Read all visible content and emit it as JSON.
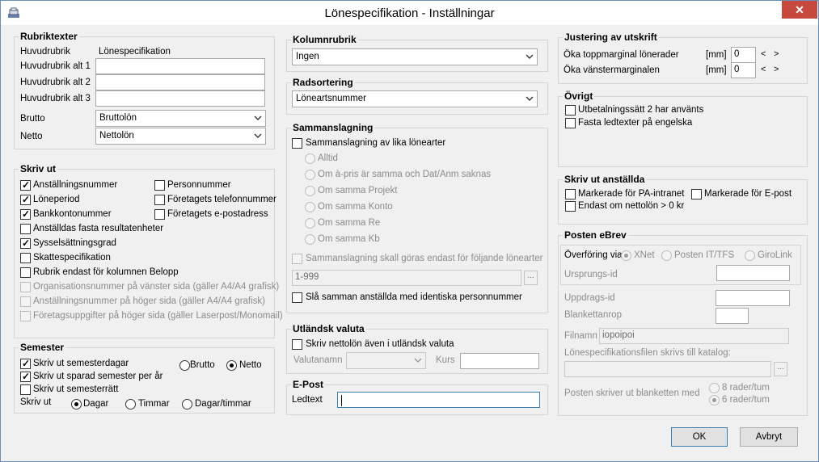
{
  "window": {
    "title": "Lönespecifikation - Inställningar",
    "close": "✕"
  },
  "rubrik": {
    "title": "Rubriktexter",
    "huvudrubrik_label": "Huvudrubrik",
    "huvudrubrik_value": "Lönespecifikation",
    "alt1_label": "Huvudrubrik alt 1",
    "alt1_value": "",
    "alt2_label": "Huvudrubrik alt 2",
    "alt2_value": "",
    "alt3_label": "Huvudrubrik alt 3",
    "alt3_value": "",
    "brutto_label": "Brutto",
    "brutto_value": "Bruttolön",
    "netto_label": "Netto",
    "netto_value": "Nettolön"
  },
  "skrivut": {
    "title": "Skriv ut",
    "items": [
      {
        "label": "Anställningsnummer",
        "checked": true,
        "enabled": true
      },
      {
        "label": "Löneperiod",
        "checked": true,
        "enabled": true
      },
      {
        "label": "Bankkontonummer",
        "checked": true,
        "enabled": true
      },
      {
        "label": "Anställdas fasta resultatenheter",
        "checked": false,
        "enabled": true
      },
      {
        "label": "Sysselsättningsgrad",
        "checked": true,
        "enabled": true
      },
      {
        "label": "Skattespecifikation",
        "checked": false,
        "enabled": true
      },
      {
        "label": "Rubrik endast för kolumnen Belopp",
        "checked": false,
        "enabled": true
      },
      {
        "label": "Organisationsnummer på vänster sida (gäller A4/A4 grafisk)",
        "checked": false,
        "enabled": false
      },
      {
        "label": "Anställningsnummer på höger sida (gäller A4/A4 grafisk)",
        "checked": false,
        "enabled": false
      },
      {
        "label": "Företagsuppgifter på höger sida (gäller Laserpost/Monomail)",
        "checked": false,
        "enabled": false
      }
    ],
    "right_items": [
      {
        "label": "Personnummer",
        "checked": false
      },
      {
        "label": "Företagets telefonnummer",
        "checked": false
      },
      {
        "label": "Företagets e-postadress",
        "checked": false
      }
    ]
  },
  "semester": {
    "title": "Semester",
    "items": [
      {
        "label": "Skriv ut semesterdagar",
        "checked": true
      },
      {
        "label": "Skriv ut sparad semester per år",
        "checked": true
      },
      {
        "label": "Skriv ut semesterrätt",
        "checked": false
      }
    ],
    "brutto_label": "Brutto",
    "netto_label": "Netto",
    "selected_bn": "Netto",
    "skrivut_label": "Skriv ut",
    "dagar_label": "Dagar",
    "timmar_label": "Timmar",
    "dagartimmar_label": "Dagar/timmar",
    "selected_unit": "Dagar"
  },
  "kolumnrubrik": {
    "title": "Kolumnrubrik",
    "value": "Ingen"
  },
  "radsortering": {
    "title": "Radsortering",
    "value": "Löneartsnummer"
  },
  "sammanslagning": {
    "title": "Sammanslagning",
    "main_label": "Sammanslagning av lika lönearter",
    "main_checked": false,
    "options": [
      "Alltid",
      "Om à-pris är samma och Dat/Anm saknas",
      "Om samma Projekt",
      "Om samma Konto",
      "Om samma Re",
      "Om samma Kb"
    ],
    "selected_option": "Om samma Kb",
    "endast_label": "Sammanslagning skall göras endast för följande lönearter",
    "endast_value": "1-999",
    "browse": "...",
    "sla_label": "Slå samman anställda med identiska personnummer",
    "sla_checked": false
  },
  "valuta": {
    "title": "Utländsk valuta",
    "check_label": "Skriv nettolön även i utländsk valuta",
    "checked": false,
    "valutanamn_label": "Valutanamn",
    "valutanamn_value": "",
    "kurs_label": "Kurs",
    "kurs_value": ""
  },
  "epost": {
    "title": "E-Post",
    "ledtext_label": "Ledtext",
    "ledtext_value": ""
  },
  "justering": {
    "title": "Justering av utskrift",
    "topp_label": "Öka toppmarginal lönerader",
    "topp_unit": "[mm]",
    "topp_value": "0",
    "vanster_label": "Öka vänstermarginalen",
    "vanster_unit": "[mm]",
    "vanster_value": "0",
    "left_arrow": "<",
    "right_arrow": ">"
  },
  "ovrigt": {
    "title": "Övrigt",
    "items": [
      {
        "label": "Utbetalningssätt 2 har använts",
        "checked": false
      },
      {
        "label": "Fasta ledtexter på engelska",
        "checked": false
      }
    ]
  },
  "anstallda": {
    "title": "Skriv ut anställda",
    "pa_label": "Markerade för PA-intranet",
    "pa_checked": false,
    "epost_label": "Markerade för E-post",
    "epost_checked": false,
    "netto_label": "Endast om nettolön > 0 kr",
    "netto_checked": false
  },
  "ebrev": {
    "title": "Posten eBrev",
    "overforing_label": "Överföring via",
    "xnet": "XNet",
    "posten": "Posten IT/TFS",
    "girolink": "GiroLink",
    "selected": "XNet",
    "ursprung_label": "Ursprungs-id",
    "ursprung_value": "",
    "uppdrag_label": "Uppdrags-id",
    "uppdrag_value": "",
    "blankett_label": "Blankettanrop",
    "blankett_value": "",
    "filnamn_label": "Filnamn",
    "filnamn_value": "iopoipoi",
    "katalog_label": "Lönespecifikationsfilen skrivs till katalog:",
    "katalog_value": "",
    "browse": "...",
    "rader_label": "Posten skriver ut blanketten med",
    "rader8": "8 rader/tum",
    "rader6": "6 rader/tum",
    "rader_selected": "6 rader/tum"
  },
  "buttons": {
    "ok": "OK",
    "cancel": "Avbryt"
  }
}
